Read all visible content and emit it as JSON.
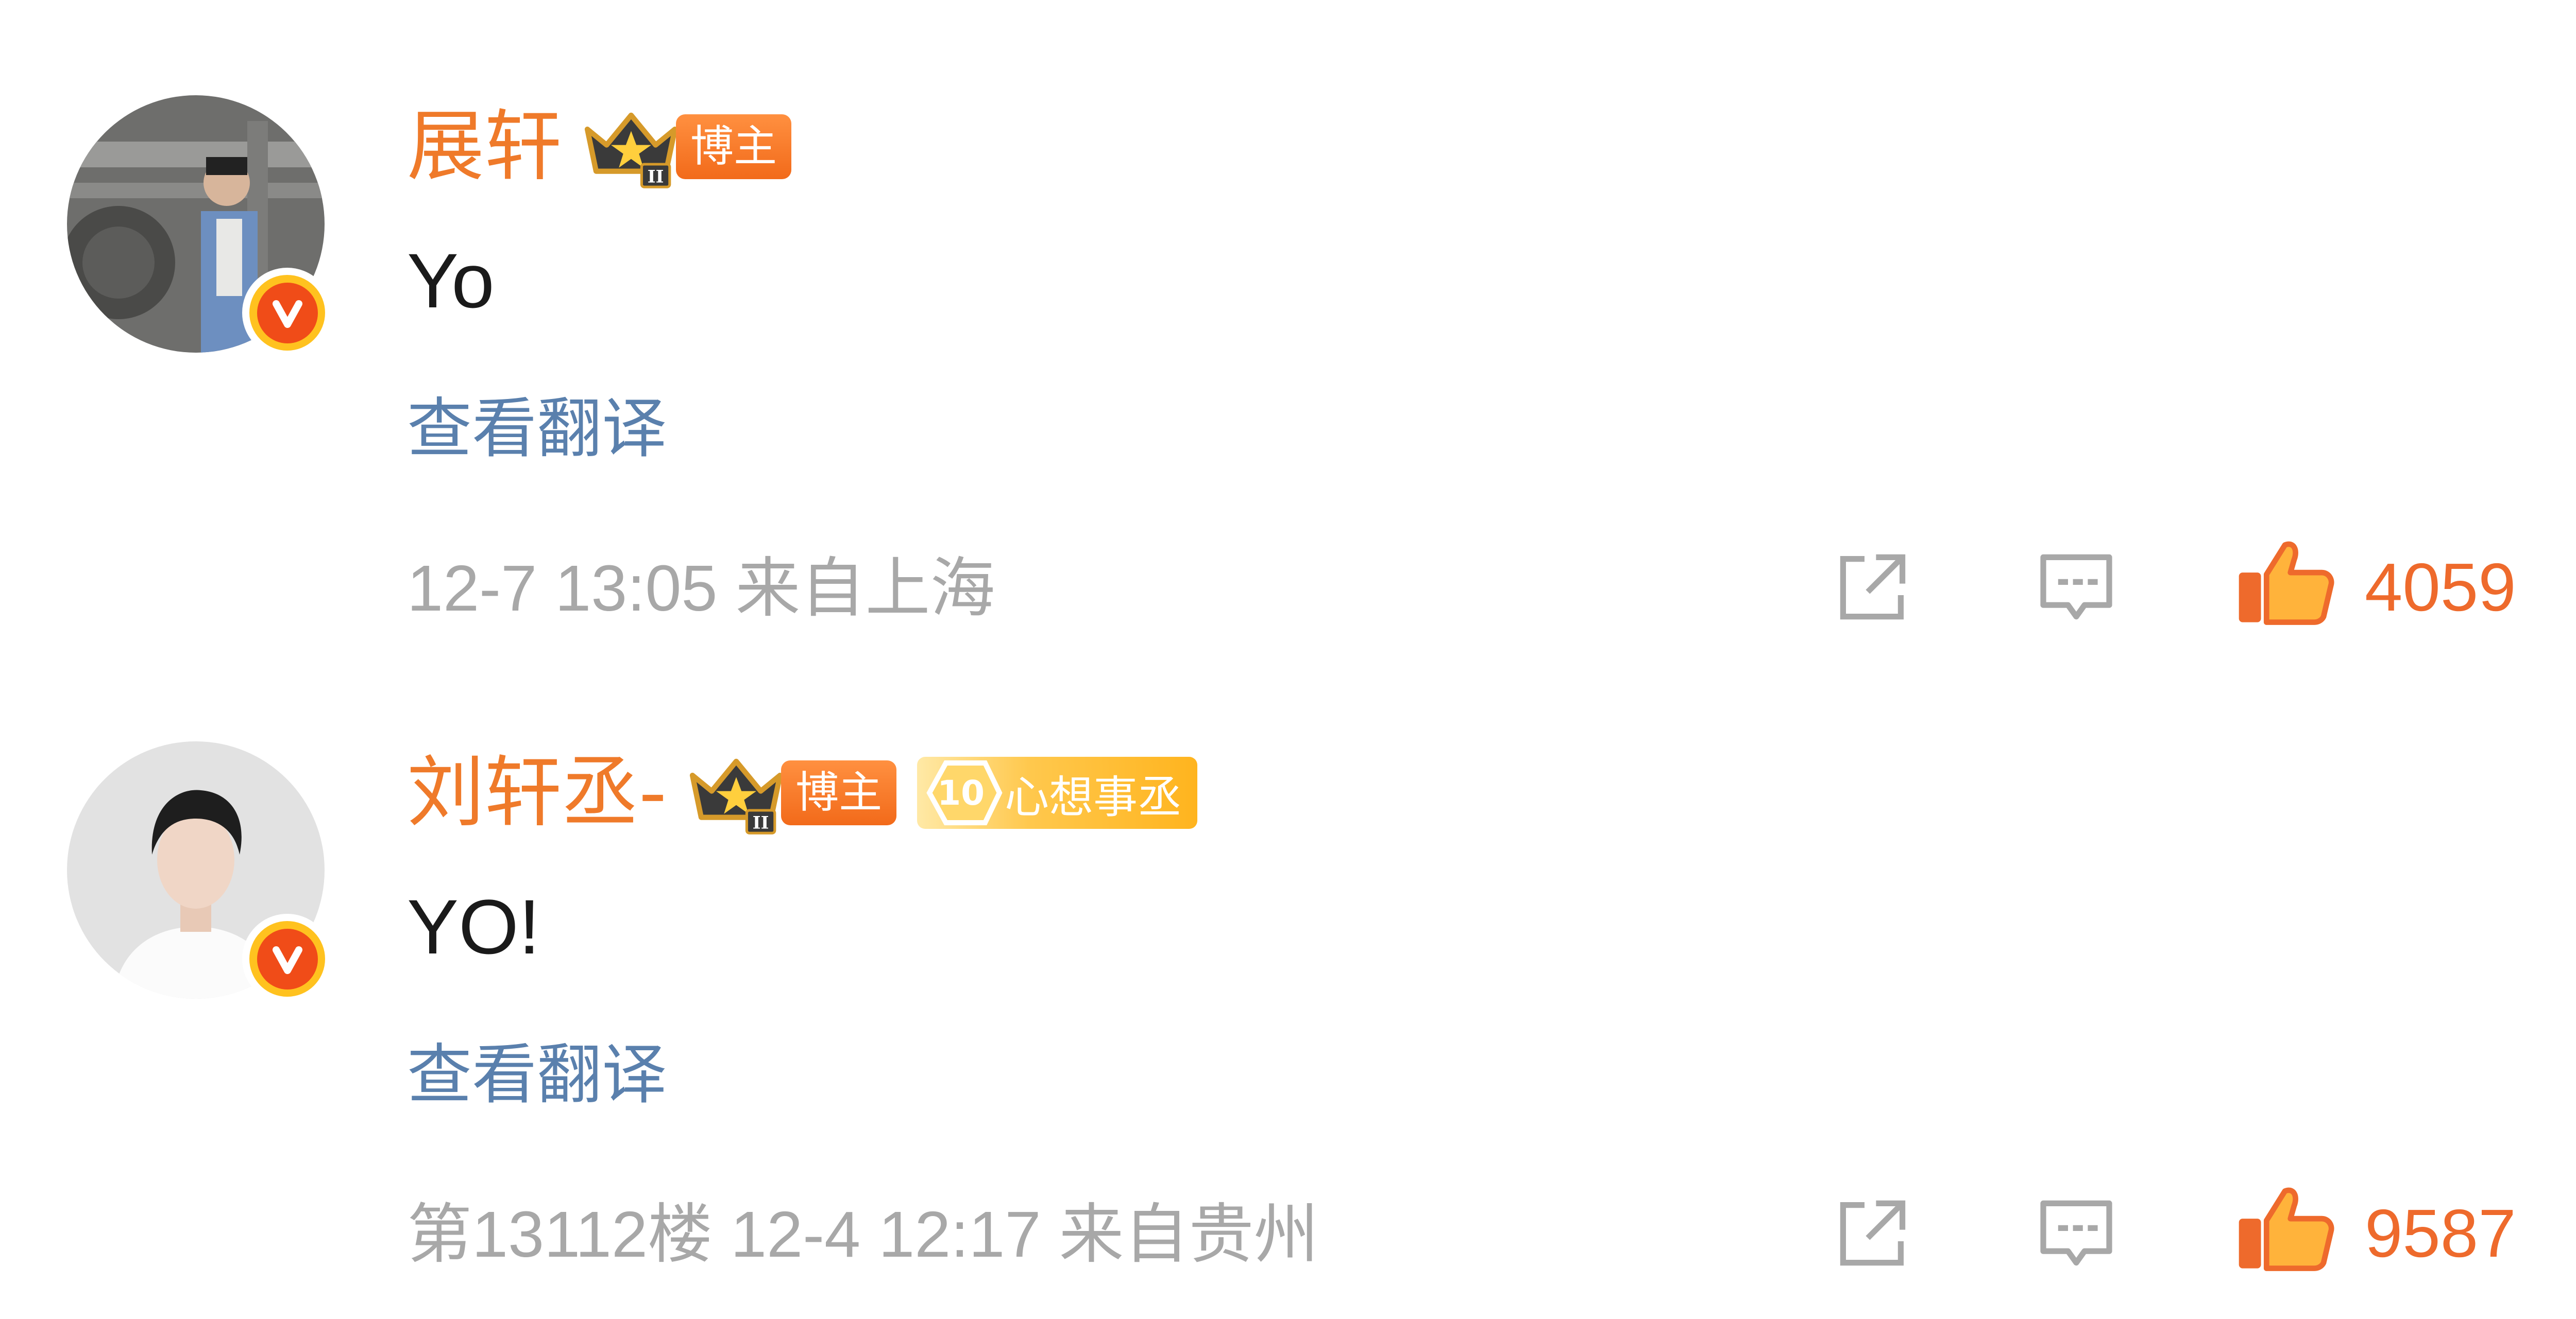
{
  "comments": [
    {
      "username": "展轩",
      "badge_label": "博主",
      "content": "Yo",
      "translate_label": "查看翻译",
      "meta": "12-7 13:05  来自上海",
      "like_count": "4059"
    },
    {
      "username": "刘轩丞-",
      "badge_label": "博主",
      "fan_level": "10",
      "fan_badge_label": "心想事丞",
      "content": "YO!",
      "translate_label": "查看翻译",
      "meta": "第13112楼  12-4 12:17  来自贵州",
      "like_count": "9587"
    }
  ],
  "icons": {
    "verified": "verified-v-icon",
    "crown": "crown-icon",
    "share": "share-icon",
    "reply": "reply-comment-icon",
    "like": "thumbs-up-icon"
  },
  "colors": {
    "username": "#ef7a2a",
    "translate": "#5a80ad",
    "meta": "#a8a8a8",
    "like_accent": "#ee6a2c"
  }
}
